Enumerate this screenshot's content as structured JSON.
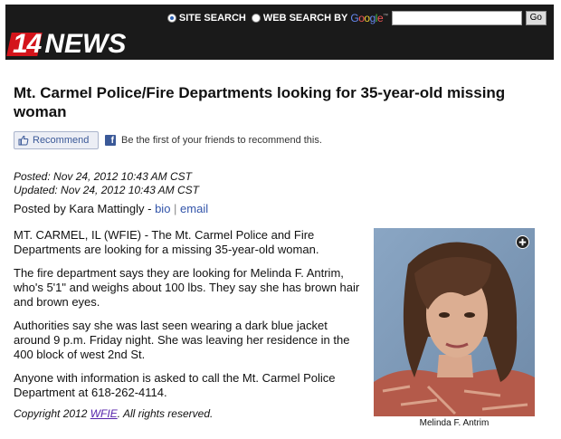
{
  "header": {
    "logo_number": "14",
    "logo_word": "NEWS",
    "site_search_label": "SITE SEARCH",
    "web_search_label": "WEB SEARCH BY",
    "google_letters": [
      "G",
      "o",
      "o",
      "g",
      "l",
      "e"
    ],
    "google_tm": "™",
    "search_value": "",
    "go_label": "Go"
  },
  "article": {
    "headline": "Mt. Carmel Police/Fire Departments looking for 35-year-old missing woman",
    "recommend_label": "Recommend",
    "fb_prompt": "Be the first of your friends to recommend this.",
    "posted": "Posted: Nov 24, 2012 10:43 AM CST",
    "updated": "Updated: Nov 24, 2012 10:43 AM CST",
    "byline_prefix": "Posted by Kara Mattingly - ",
    "bio_link": "bio",
    "separator": " | ",
    "email_link": "email",
    "paragraphs": [
      "MT. CARMEL, IL (WFIE) - The Mt. Carmel Police and Fire Departments are looking for a missing 35-year-old woman.",
      "The fire department says they are looking for Melinda F. Antrim, who's 5'1\" and weighs about 100 lbs. They say she has brown hair and brown eyes.",
      "Authorities say she was last seen wearing a dark blue jacket around 9 p.m. Friday night. She was leaving her residence in the 400 block of west 2nd St.",
      "Anyone with information is asked to call the Mt. Carmel Police Department at 618-262-4114."
    ],
    "copyright_prefix": "Copyright 2012 ",
    "copyright_link": "WFIE",
    "copyright_suffix": ". All rights reserved.",
    "photo_caption": "Melinda F. Antrim"
  },
  "colors": {
    "header_bg": "#1a1a1a",
    "logo_red": "#d4141b",
    "facebook_blue": "#3b5998",
    "link_blue": "#3355aa",
    "photo_background": "#7b97b4"
  },
  "icons": {
    "recommend": "thumbs-up-icon",
    "facebook": "facebook-icon",
    "photo_expand": "plus-circle-icon"
  }
}
